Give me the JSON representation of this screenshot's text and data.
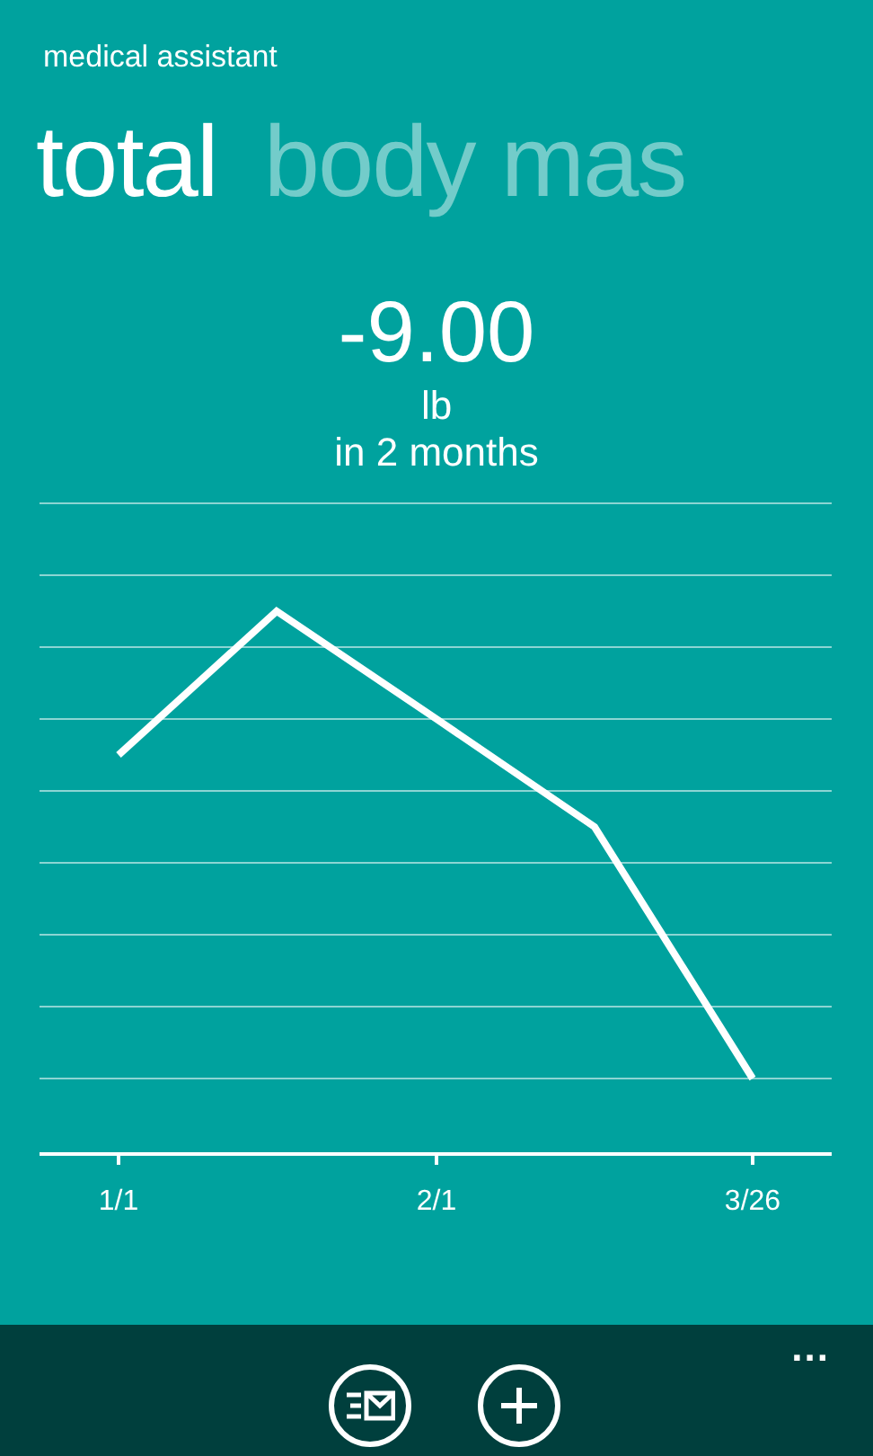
{
  "app_title": "medical assistant",
  "pivot": [
    {
      "label": "total",
      "selected": true
    },
    {
      "label": "body mas",
      "selected": false
    }
  ],
  "summary": {
    "value": "-9.00",
    "unit": "lb",
    "period": "in 2 months"
  },
  "chart": {
    "x_labels": [
      "1/1",
      "2/1",
      "3/26"
    ]
  },
  "app_bar": {
    "more": "..."
  }
}
